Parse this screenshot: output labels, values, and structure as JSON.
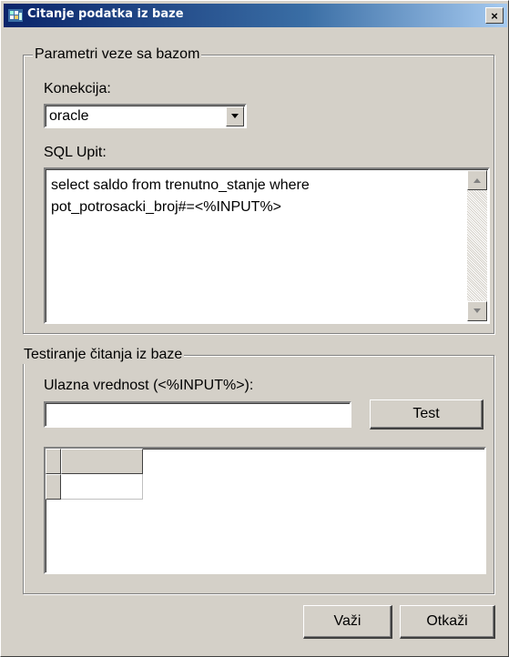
{
  "window": {
    "title": "Citanje podatka iz baze",
    "close_glyph": "×"
  },
  "connection_group": {
    "legend": "Parametri veze sa bazom",
    "connection_label": "Konekcija:",
    "connection_value": "oracle",
    "sql_label": "SQL Upit:",
    "sql_text": "select saldo from trenutno_stanje where\npot_potrosacki_broj#=<%INPUT%>"
  },
  "test_group": {
    "legend": "Testiranje čitanja iz baze",
    "input_label": "Ulazna vrednost (<%INPUT%>):",
    "input_value": "",
    "test_button": "Test"
  },
  "footer": {
    "ok_button": "Važi",
    "cancel_button": "Otkaži"
  },
  "icons": {
    "title": "window-app-icon",
    "dropdown": "chevron-down-icon",
    "scroll_up": "arrow-up-icon",
    "scroll_down": "arrow-down-icon"
  },
  "colors": {
    "titlebar_start": "#0a246a",
    "titlebar_end": "#a6caf0",
    "face": "#d4d0c8"
  }
}
